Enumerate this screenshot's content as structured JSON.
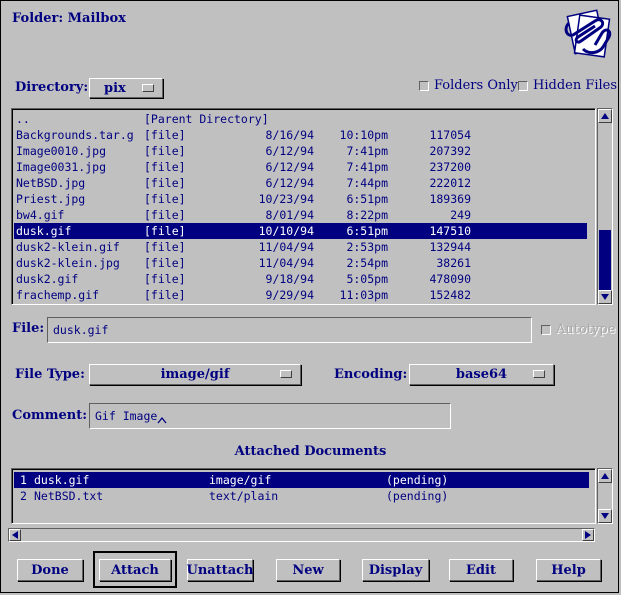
{
  "window": {
    "title": "Folder: Mailbox"
  },
  "directory": {
    "label": "Directory:",
    "value": "pix",
    "folders_only": "Folders Only",
    "hidden_files": "Hidden Files"
  },
  "files": [
    {
      "name": "..",
      "type": "[Parent Directory]",
      "date": "",
      "time": "",
      "size": ""
    },
    {
      "name": "Backgrounds.tar.g",
      "type": "[file]",
      "date": "8/16/94",
      "time": "10:10pm",
      "size": "117054"
    },
    {
      "name": "Image0010.jpg",
      "type": "[file]",
      "date": "6/12/94",
      "time": "7:41pm",
      "size": "207392"
    },
    {
      "name": "Image0031.jpg",
      "type": "[file]",
      "date": "6/12/94",
      "time": "7:41pm",
      "size": "237200"
    },
    {
      "name": "NetBSD.jpg",
      "type": "[file]",
      "date": "6/12/94",
      "time": "7:44pm",
      "size": "222012"
    },
    {
      "name": "Priest.jpg",
      "type": "[file]",
      "date": "10/23/94",
      "time": "6:51pm",
      "size": "189369"
    },
    {
      "name": "bw4.gif",
      "type": "[file]",
      "date": "8/01/94",
      "time": "8:22pm",
      "size": "249"
    },
    {
      "name": "dusk.gif",
      "type": "[file]",
      "date": "10/10/94",
      "time": "6:51pm",
      "size": "147510",
      "selected": true
    },
    {
      "name": "dusk2-klein.gif",
      "type": "[file]",
      "date": "11/04/94",
      "time": "2:53pm",
      "size": "132944"
    },
    {
      "name": "dusk2-klein.jpg",
      "type": "[file]",
      "date": "11/04/94",
      "time": "2:54pm",
      "size": "38261"
    },
    {
      "name": "dusk2.gif",
      "type": "[file]",
      "date": "9/18/94",
      "time": "5:05pm",
      "size": "478090"
    },
    {
      "name": "frachemp.gif",
      "type": "[file]",
      "date": "9/29/94",
      "time": "11:03pm",
      "size": "152482"
    }
  ],
  "file_field": {
    "label": "File:",
    "value": "dusk.gif",
    "autotype": "Autotype"
  },
  "file_type": {
    "label": "File Type:",
    "value": "image/gif"
  },
  "encoding": {
    "label": "Encoding:",
    "value": "base64"
  },
  "comment": {
    "label": "Comment:",
    "value": "Gif Image"
  },
  "attached": {
    "title": "Attached Documents",
    "items": [
      {
        "num": "1",
        "name": "dusk.gif",
        "type": "image/gif",
        "status": "(pending)",
        "selected": true
      },
      {
        "num": "2",
        "name": "NetBSD.txt",
        "type": "text/plain",
        "status": "(pending)"
      }
    ]
  },
  "buttons": {
    "done": "Done",
    "attach": "Attach",
    "unattach": "Unattach",
    "new": "New",
    "display": "Display",
    "edit": "Edit",
    "help": "Help"
  },
  "colors": {
    "background": "#c0c0c0",
    "text": "#000080",
    "selection": "#000080"
  }
}
